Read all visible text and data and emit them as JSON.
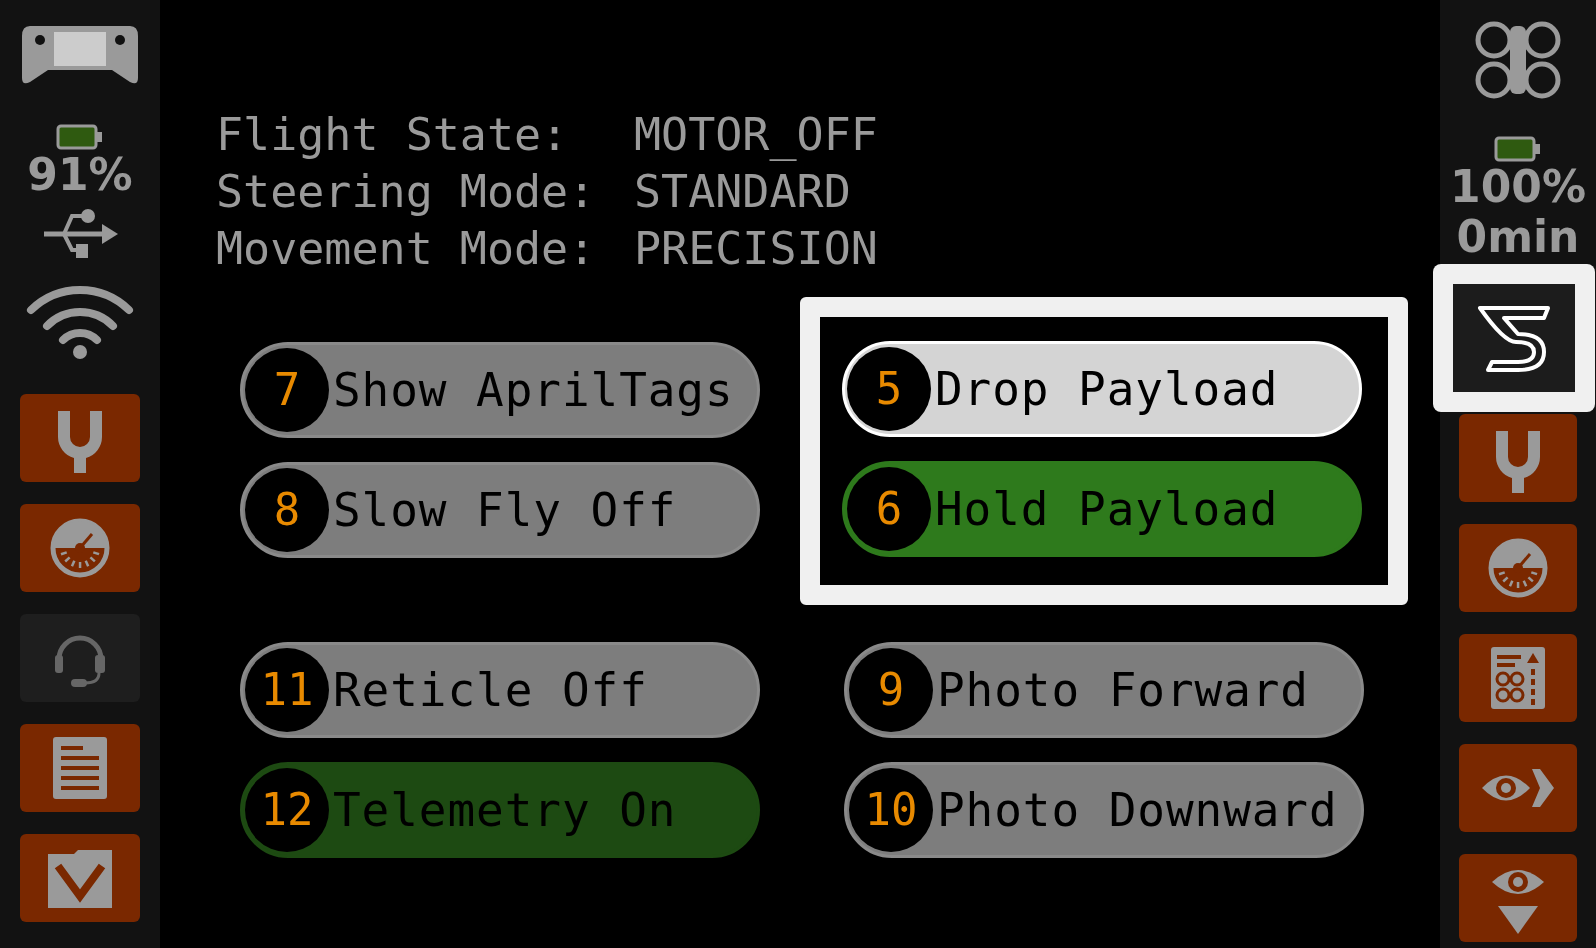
{
  "left_sidebar": {
    "items": [
      {
        "kind": "controller"
      },
      {
        "kind": "battery"
      },
      {
        "kind": "reading",
        "text": "91%"
      },
      {
        "kind": "usb"
      },
      {
        "kind": "wifi"
      },
      {
        "kind": "button",
        "disabled": false
      },
      {
        "kind": "button",
        "disabled": false
      },
      {
        "kind": "button",
        "disabled": true
      },
      {
        "kind": "button",
        "disabled": false
      },
      {
        "kind": "button",
        "disabled": false
      }
    ]
  },
  "right_sidebar": {
    "items": [
      {
        "kind": "drone"
      },
      {
        "kind": "battery"
      },
      {
        "kind": "reading",
        "text": "100%"
      },
      {
        "kind": "reading",
        "text": "0min"
      },
      {
        "kind": "button",
        "selected": true
      },
      {
        "kind": "button",
        "selected": false
      },
      {
        "kind": "button",
        "selected": false
      },
      {
        "kind": "button",
        "selected": false
      },
      {
        "kind": "button",
        "selected": false
      },
      {
        "kind": "button",
        "selected": false
      }
    ]
  },
  "status": [
    {
      "label": "Flight State:",
      "value": "MOTOR_OFF"
    },
    {
      "label": "Steering Mode:",
      "value": "STANDARD"
    },
    {
      "label": "Movement Mode:",
      "value": "PRECISION"
    }
  ],
  "button_groups": [
    {
      "focused": false,
      "buttons": [
        {
          "number": "7",
          "label": "Show AprilTags",
          "on": false
        },
        {
          "number": "8",
          "label": "Slow Fly Off",
          "on": false
        }
      ]
    },
    {
      "focused": true,
      "buttons": [
        {
          "number": "5",
          "label": "Drop Payload",
          "on": false
        },
        {
          "number": "6",
          "label": "Hold Payload",
          "on": true
        }
      ]
    },
    {
      "focused": false,
      "buttons": [
        {
          "number": "11",
          "label": "Reticle Off",
          "on": false
        },
        {
          "number": "12",
          "label": "Telemetry On",
          "on": true
        }
      ]
    },
    {
      "focused": false,
      "buttons": [
        {
          "number": "9",
          "label": "Photo Forward",
          "on": false
        },
        {
          "number": "10",
          "label": "Photo Downward",
          "on": false
        }
      ]
    }
  ]
}
